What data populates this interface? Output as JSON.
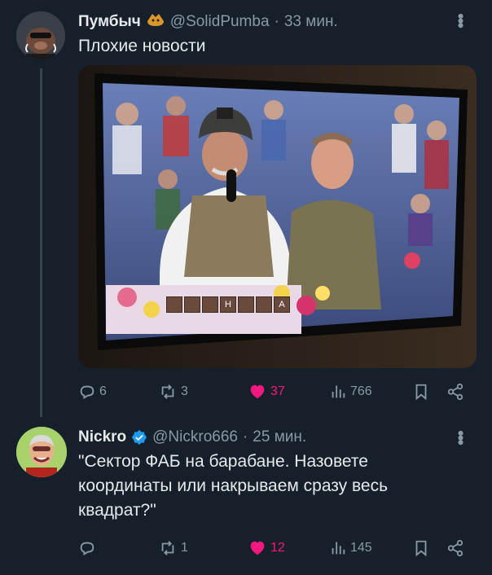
{
  "tweets": [
    {
      "author": "Пумбыч",
      "handle": "@SolidPumba",
      "time": "33 мин.",
      "text": "Плохие новости",
      "stats": {
        "replies": "6",
        "retweets": "3",
        "likes": "37",
        "views": "766"
      }
    },
    {
      "author": "Nickro",
      "handle": "@Nickro666",
      "time": "25 мин.",
      "text_lines": [
        "\"Сектор ФАБ на барабане. Назовете",
        "координаты или накрываем сразу весь",
        "квадрат?\""
      ],
      "stats": {
        "replies": "",
        "retweets": "1",
        "likes": "12",
        "views": "145"
      }
    }
  ],
  "media": {
    "board_letters": [
      "",
      "",
      "",
      "Н",
      "",
      "",
      "А"
    ]
  },
  "icons": {
    "reply": "reply-icon",
    "retweet": "retweet-icon",
    "like": "heart-icon",
    "views": "views-icon",
    "bookmark": "bookmark-icon",
    "share": "share-icon",
    "verified": "verified-badge-icon",
    "more": "more-icon",
    "emoji": "pig-emoji-icon"
  },
  "colors": {
    "background": "#15202b",
    "text": "#e7e9ea",
    "muted": "#8b98a5",
    "like": "#f91880",
    "verified": "#1d9bf0"
  }
}
